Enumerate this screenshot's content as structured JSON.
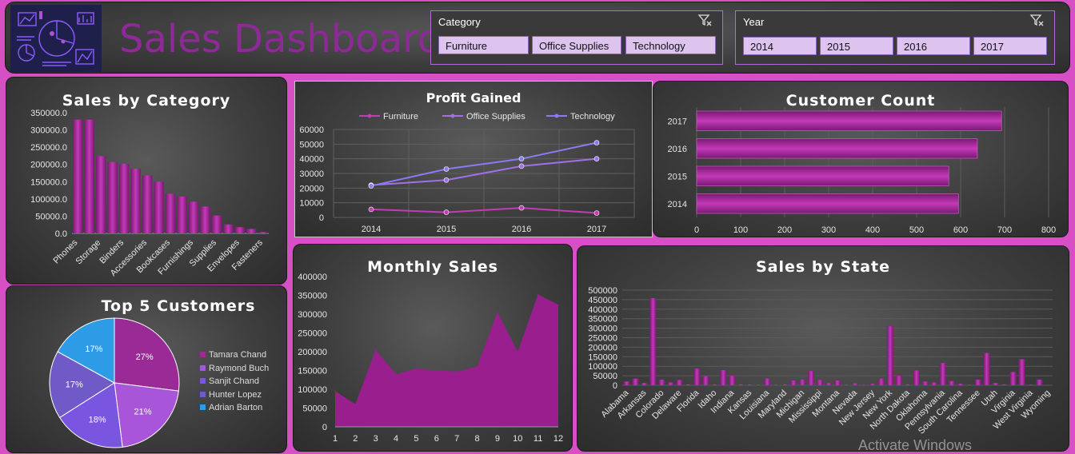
{
  "header": {
    "title": "Sales Dashboard",
    "logo_icon": "analytics-collage-icon",
    "category_slicer": {
      "label": "Category",
      "options": [
        "Furniture",
        "Office Supplies",
        "Technology"
      ]
    },
    "year_slicer": {
      "label": "Year",
      "options": [
        "2014",
        "2015",
        "2016",
        "2017"
      ]
    }
  },
  "watermark": "Activate Windows",
  "colors": {
    "bar": "#9b1f90",
    "line_furniture": "#c23cb5",
    "line_office": "#a070e8",
    "line_tech": "#8a7cf0",
    "area": "#9a1f8e"
  },
  "chart_data": [
    {
      "id": "sales_by_category",
      "type": "bar",
      "title": "Sales by Category",
      "category_labels_shown": [
        "Phones",
        "Storage",
        "Binders",
        "Accessories",
        "Bookcases",
        "Furnishings",
        "Supplies",
        "Envelopes",
        "Fasteners"
      ],
      "values": [
        330000,
        330000,
        224000,
        207000,
        202000,
        188000,
        168000,
        150000,
        115000,
        107000,
        92000,
        78000,
        52000,
        26000,
        18000,
        13000,
        4000
      ],
      "ylim": [
        0,
        350000
      ],
      "yticks": [
        "0.0",
        "50000.0",
        "100000.0",
        "150000.0",
        "200000.0",
        "250000.0",
        "300000.0",
        "350000.0"
      ]
    },
    {
      "id": "profit_gained",
      "type": "line",
      "title": "Profit Gained",
      "x": [
        "2014",
        "2015",
        "2016",
        "2017"
      ],
      "series": [
        {
          "name": "Furniture",
          "values": [
            5500,
            3500,
            6500,
            3000
          ]
        },
        {
          "name": "Office Supplies",
          "values": [
            22000,
            25500,
            35000,
            40000
          ]
        },
        {
          "name": "Technology",
          "values": [
            21500,
            33000,
            40000,
            51000
          ]
        }
      ],
      "ylim": [
        0,
        60000
      ],
      "yticks": [
        "0",
        "10000",
        "20000",
        "30000",
        "40000",
        "50000",
        "60000"
      ]
    },
    {
      "id": "customer_count",
      "type": "bar",
      "title": "Customer Count",
      "categories": [
        "2014",
        "2015",
        "2016",
        "2017"
      ],
      "values": [
        595,
        573,
        638,
        693
      ],
      "xlim": [
        0,
        800
      ],
      "xticks": [
        "0",
        "100",
        "200",
        "300",
        "400",
        "500",
        "600",
        "700",
        "800"
      ]
    },
    {
      "id": "top_customers",
      "type": "pie",
      "title": "Top 5 Customers",
      "labels": [
        "Tamara Chand",
        "Raymond Buch",
        "Sanjit Chand",
        "Hunter Lopez",
        "Adrian Barton"
      ],
      "values": [
        27,
        21,
        18,
        17,
        17
      ],
      "value_labels": [
        "27%",
        "21%",
        "18%",
        "17%",
        "17%"
      ],
      "colors": [
        "#9a2a96",
        "#a955d9",
        "#7a55e0",
        "#6f5ac8",
        "#2e9be6"
      ]
    },
    {
      "id": "monthly_sales",
      "type": "area",
      "title": "Monthly Sales",
      "x": [
        "1",
        "2",
        "3",
        "4",
        "5",
        "6",
        "7",
        "8",
        "9",
        "10",
        "11",
        "12"
      ],
      "values": [
        95000,
        60000,
        205000,
        140000,
        155000,
        150000,
        147000,
        160000,
        305000,
        200000,
        352000,
        325000
      ],
      "ylim": [
        0,
        400000
      ],
      "yticks": [
        "0",
        "50000",
        "100000",
        "150000",
        "200000",
        "250000",
        "300000",
        "350000",
        "400000"
      ]
    },
    {
      "id": "sales_by_state",
      "type": "bar",
      "title": "Sales by State",
      "category_labels_shown": [
        "Alabama",
        "Arkansas",
        "Colorado",
        "Delaware",
        "Florida",
        "Idaho",
        "Indiana",
        "Kansas",
        "Louisiana",
        "Maryland",
        "Michigan",
        "Mississippi",
        "Montana",
        "Nevada",
        "New Jersey",
        "New York",
        "North Dakota",
        "Oklahoma",
        "Pennsylvania",
        "South Carolina",
        "Tennessee",
        "Utah",
        "Virginia",
        "West Virginia",
        "Wyoming"
      ],
      "values": [
        20000,
        35000,
        12000,
        458000,
        30000,
        15000,
        28000,
        5000,
        88000,
        48000,
        5000,
        80000,
        50000,
        5000,
        4000,
        3000,
        35000,
        3000,
        5000,
        25000,
        30000,
        75000,
        28000,
        12000,
        25000,
        3000,
        10000,
        2000,
        8000,
        35000,
        310000,
        50000,
        5000,
        78000,
        20000,
        15000,
        117000,
        22000,
        8000,
        3000,
        30000,
        170000,
        12000,
        5000,
        70000,
        137000,
        3000,
        30000,
        1000
      ],
      "ylim": [
        0,
        500000
      ],
      "yticks": [
        "0",
        "50000",
        "100000",
        "150000",
        "200000",
        "250000",
        "300000",
        "350000",
        "400000",
        "450000",
        "500000"
      ]
    }
  ]
}
